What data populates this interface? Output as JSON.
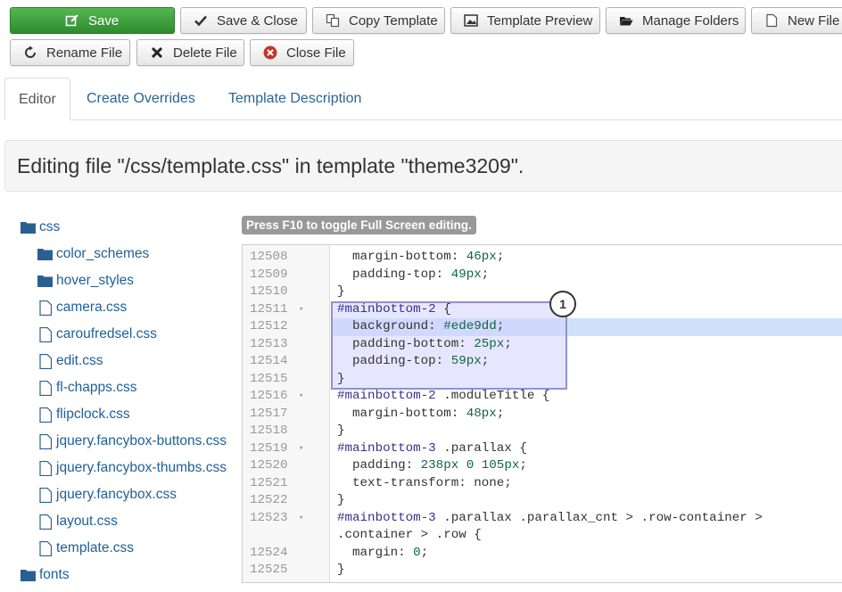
{
  "toolbar": {
    "save": "Save",
    "save_close": "Save & Close",
    "copy_template": "Copy Template",
    "template_preview": "Template Preview",
    "manage_folders": "Manage Folders",
    "new_file": "New File",
    "rename_file": "Rename File",
    "delete_file": "Delete File",
    "close_file": "Close File"
  },
  "tabs": [
    {
      "label": "Editor",
      "active": true
    },
    {
      "label": "Create Overrides",
      "active": false
    },
    {
      "label": "Template Description",
      "active": false
    }
  ],
  "heading": "Editing file \"/css/template.css\" in template \"theme3209\".",
  "tree": [
    {
      "label": "css",
      "kind": "folder"
    },
    {
      "label": "color_schemes",
      "kind": "folder"
    },
    {
      "label": "hover_styles",
      "kind": "folder"
    },
    {
      "label": "camera.css",
      "kind": "file"
    },
    {
      "label": "caroufredsel.css",
      "kind": "file"
    },
    {
      "label": "edit.css",
      "kind": "file"
    },
    {
      "label": "fl-chapps.css",
      "kind": "file"
    },
    {
      "label": "flipclock.css",
      "kind": "file"
    },
    {
      "label": "jquery.fancybox-buttons.css",
      "kind": "file"
    },
    {
      "label": "jquery.fancybox-thumbs.css",
      "kind": "file"
    },
    {
      "label": "jquery.fancybox.css",
      "kind": "file"
    },
    {
      "label": "layout.css",
      "kind": "file"
    },
    {
      "label": "template.css",
      "kind": "file"
    },
    {
      "label": "fonts",
      "kind": "folder"
    }
  ],
  "hint": "Press F10 to toggle Full Screen editing.",
  "callout_number": "1",
  "colors": {
    "save_green": "#46a546",
    "link_blue": "#1f5f99",
    "highlight": "#cfe0fb"
  },
  "code_lines": [
    {
      "n": "12508",
      "fold": false,
      "text": "  margin-bottom: 46px;"
    },
    {
      "n": "12509",
      "fold": false,
      "text": "  padding-top: 49px;"
    },
    {
      "n": "12510",
      "fold": false,
      "text": "}"
    },
    {
      "n": "12511",
      "fold": true,
      "text": "#mainbottom-2 {"
    },
    {
      "n": "12512",
      "fold": false,
      "text": "  background: #ede9dd;"
    },
    {
      "n": "12513",
      "fold": false,
      "text": "  padding-bottom: 25px;"
    },
    {
      "n": "12514",
      "fold": false,
      "text": "  padding-top: 59px;"
    },
    {
      "n": "12515",
      "fold": false,
      "text": "}"
    },
    {
      "n": "12516",
      "fold": true,
      "text": "#mainbottom-2 .moduleTitle {"
    },
    {
      "n": "12517",
      "fold": false,
      "text": "  margin-bottom: 48px;"
    },
    {
      "n": "12518",
      "fold": false,
      "text": "}"
    },
    {
      "n": "12519",
      "fold": true,
      "text": "#mainbottom-3 .parallax {"
    },
    {
      "n": "12520",
      "fold": false,
      "text": "  padding: 238px 0 105px;"
    },
    {
      "n": "12521",
      "fold": false,
      "text": "  text-transform: none;"
    },
    {
      "n": "12522",
      "fold": false,
      "text": "}"
    },
    {
      "n": "12523",
      "fold": true,
      "text": "#mainbottom-3 .parallax .parallax_cnt > .row-container >"
    },
    {
      "n": "",
      "fold": false,
      "text": ".container > .row {"
    },
    {
      "n": "12524",
      "fold": false,
      "text": "  margin: 0;"
    },
    {
      "n": "12525",
      "fold": false,
      "text": "}"
    }
  ]
}
